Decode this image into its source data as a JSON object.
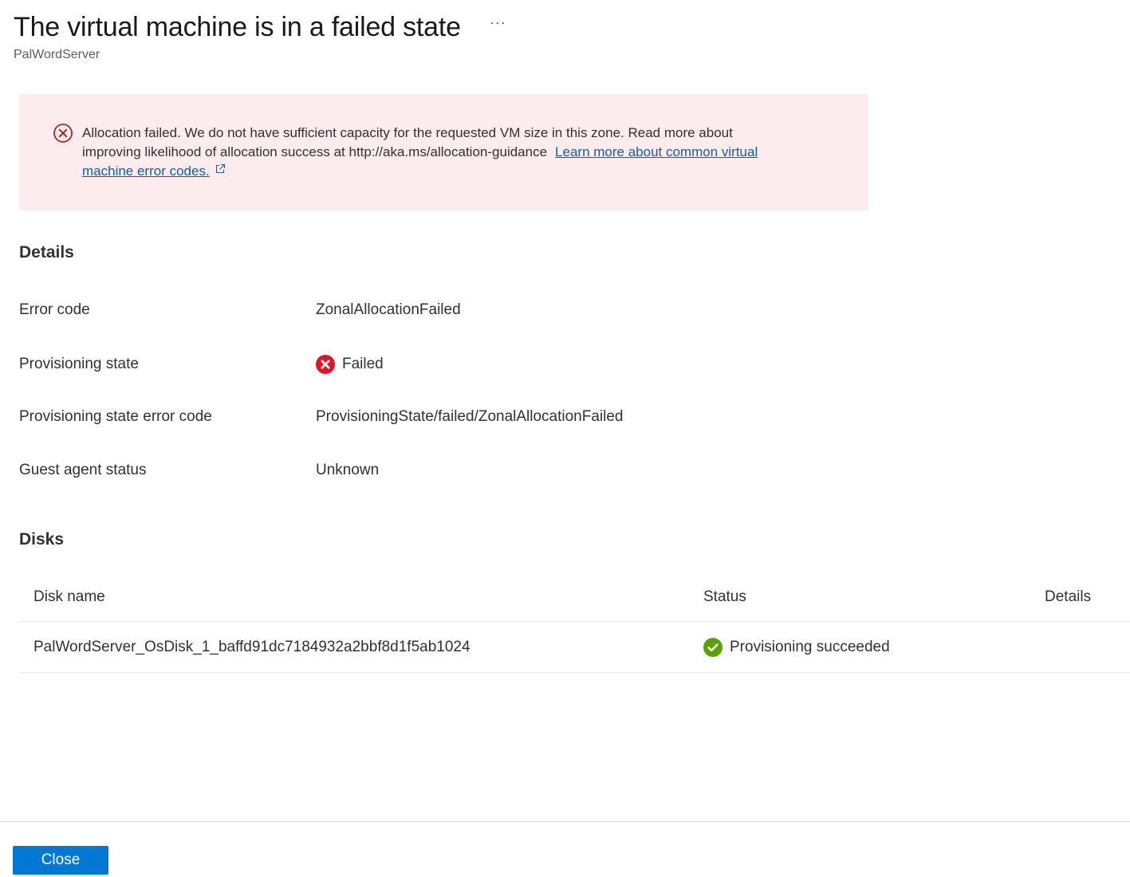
{
  "header": {
    "title": "The virtual machine is in a failed state",
    "subtitle": "PalWordServer",
    "more_label": "···"
  },
  "banner": {
    "icon": "error-circle-icon",
    "message_line1": "Allocation failed. We do not have sufficient capacity for the requested VM size in this zone. Read more about",
    "message_line2": "improving likelihood of allocation success at http://aka.ms/allocation-guidance",
    "link_part1": "Learn more about common virtual",
    "link_part2": "machine error codes.",
    "link_icon": "external-link-icon",
    "background_color": "#fdeced",
    "icon_color": "#a4262c"
  },
  "details": {
    "title": "Details",
    "rows": [
      {
        "label": "Error code",
        "value": "ZonalAllocationFailed"
      },
      {
        "label": "Provisioning state",
        "value": "Failed",
        "icon": "error-filled-icon",
        "icon_color": "#e81123"
      },
      {
        "label": "Provisioning state error code",
        "value": "ProvisioningState/failed/ZonalAllocationFailed"
      },
      {
        "label": "Guest agent status",
        "value": "Unknown"
      }
    ]
  },
  "disks": {
    "title": "Disks",
    "columns": [
      "Disk name",
      "Status",
      "Details"
    ],
    "rows": [
      {
        "name": "PalWordServer_OsDisk_1_baffd91dc7184932a2bbf8d1f5ab1024",
        "status": "Provisioning succeeded",
        "status_icon": "success-check-icon",
        "status_color": "#57a300",
        "details": ""
      }
    ]
  },
  "footer": {
    "close_label": "Close",
    "accent_color": "#0078d4"
  }
}
